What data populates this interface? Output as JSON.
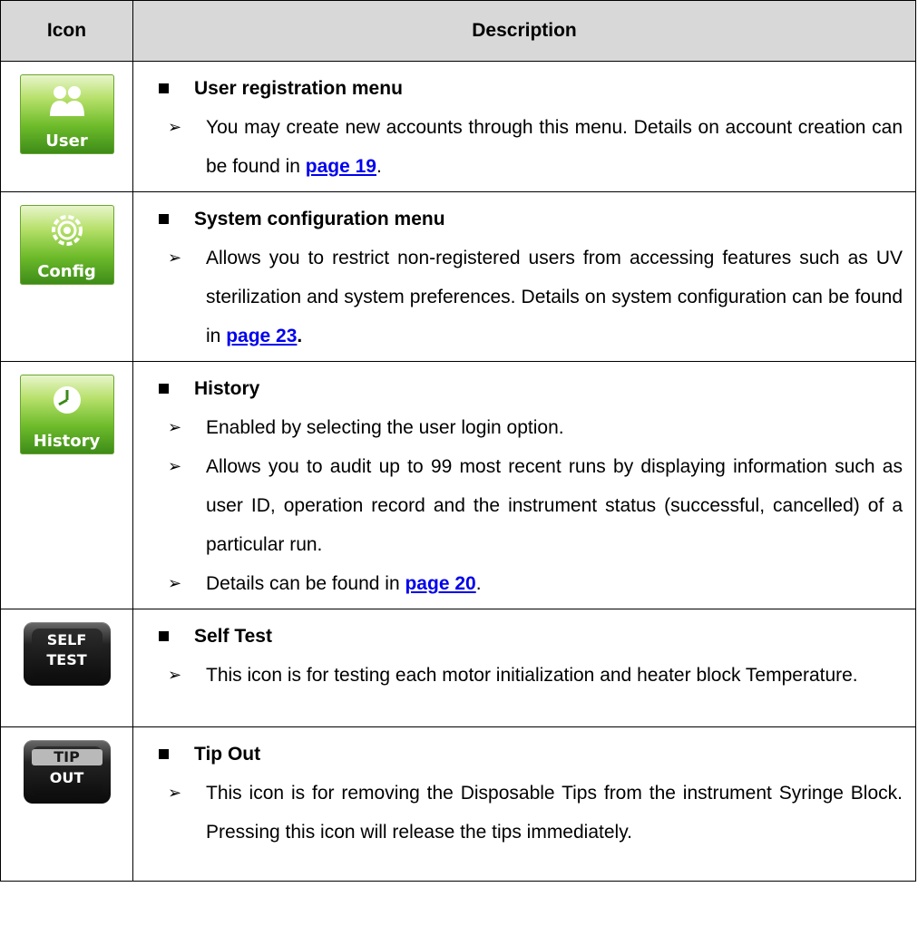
{
  "table": {
    "col_icon": "Icon",
    "col_description": "Description"
  },
  "rows": [
    {
      "icon_label": "User",
      "title": "User registration menu",
      "b1_text": "You may create new accounts through this menu. Details on account creation can be found in ",
      "b1_link": "page 19",
      "b1_end": "."
    },
    {
      "icon_label": "Config",
      "title": "System configuration menu",
      "b1_text": "Allows you to restrict non-registered users from accessing features such as UV sterilization and system preferences. Details on system configuration can be found in ",
      "b1_link": "page 23",
      "b1_end": "."
    },
    {
      "icon_label": "History",
      "title": "History",
      "b1_text": "Enabled by selecting the user login option.",
      "b2_text": "Allows you to audit up to 99 most recent runs by displaying information such as user ID, operation record and the instrument status (successful, cancelled) of a particular run.",
      "b3_text": "Details can be found in ",
      "b3_link": "page 20",
      "b3_end": "."
    },
    {
      "icon_line1": "SELF",
      "icon_line2": "TEST",
      "title": "Self Test",
      "b1_text": "This icon is for testing each motor initialization and heater block Temperature."
    },
    {
      "icon_line1": "TIP",
      "icon_line2": "OUT",
      "title": "Tip Out",
      "b1_text": "This icon is for removing the Disposable Tips from the instrument Syringe Block. Pressing this icon will release the tips immediately."
    }
  ],
  "glyphs": {
    "square": "■",
    "arrow": "➢"
  },
  "icons": [
    "user-icon",
    "config-gear-icon",
    "history-clock-icon",
    "self-test-icon",
    "tip-out-icon"
  ],
  "colors": {
    "header_bg": "#d8d8d8",
    "link": "#0000ee",
    "icon_green": "#6dbb2a",
    "icon_black": "#0b0b0b"
  }
}
